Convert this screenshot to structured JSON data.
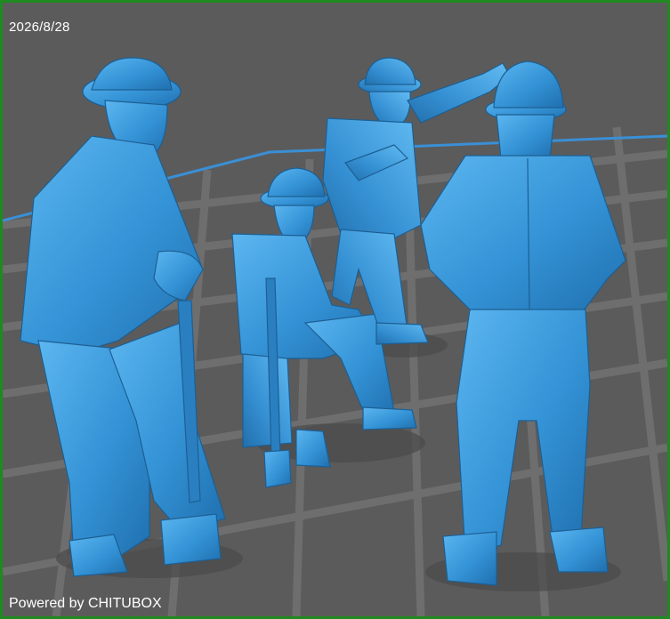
{
  "viewer": {
    "date_stamp": "2026/8/28",
    "watermark": "Powered by CHITUBOX"
  },
  "scene": {
    "background_color": "#5b5b5b",
    "grid_color": "#6f6f6f",
    "platform_edge_color": "#3a8fd6",
    "model_color": "#3c9bdc",
    "frame_color": "#1f8a1f",
    "figures": [
      "worker-with-axe",
      "seated-worker",
      "pointing-foreman",
      "standing-worker-back"
    ]
  }
}
